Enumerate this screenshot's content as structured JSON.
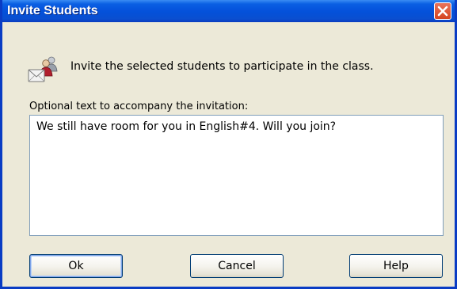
{
  "window": {
    "title": "Invite Students",
    "close_icon": "close-icon"
  },
  "header": {
    "icon": "envelope-students-icon",
    "message": "Invite the selected students to participate in the class."
  },
  "form": {
    "optional_label": "Optional text to accompany the invitation:",
    "invitation_text": "We still have room for you in English#4. Will you join?"
  },
  "buttons": {
    "ok_label": "Ok",
    "cancel_label": "Cancel",
    "help_label": "Help"
  },
  "colors": {
    "titlebar": "#0a5fe3",
    "dialog_background": "#ece9d8",
    "close_button": "#d5441f"
  }
}
